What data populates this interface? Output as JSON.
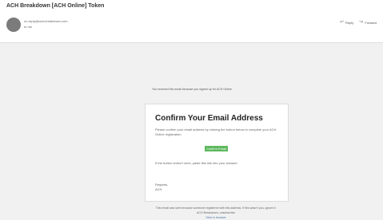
{
  "email": {
    "subject": "ACH Breakdown [ACH Online] Token",
    "from": "no-reply@ach-breakdown.com",
    "to": "to me",
    "actions": {
      "reply": "Reply",
      "forward": "Forward"
    }
  },
  "message": {
    "banner": "You received this email because you signed up for ACH Online",
    "title": "Confirm Your Email Address",
    "intro": "Please confirm your email address by clicking the button below to complete your ACH Online registration.",
    "confirm_button": "Confirm Email",
    "fallback": "If the button doesn't work, paste this link into your browser.",
    "regards": "Regards,",
    "signature": "ACH"
  },
  "footer": {
    "line1": "This email was sent because someone registered with this address. If this wasn't you, ignore it.",
    "line2": "ACH Breakdown, unsubscribe",
    "link": "View in browser"
  }
}
